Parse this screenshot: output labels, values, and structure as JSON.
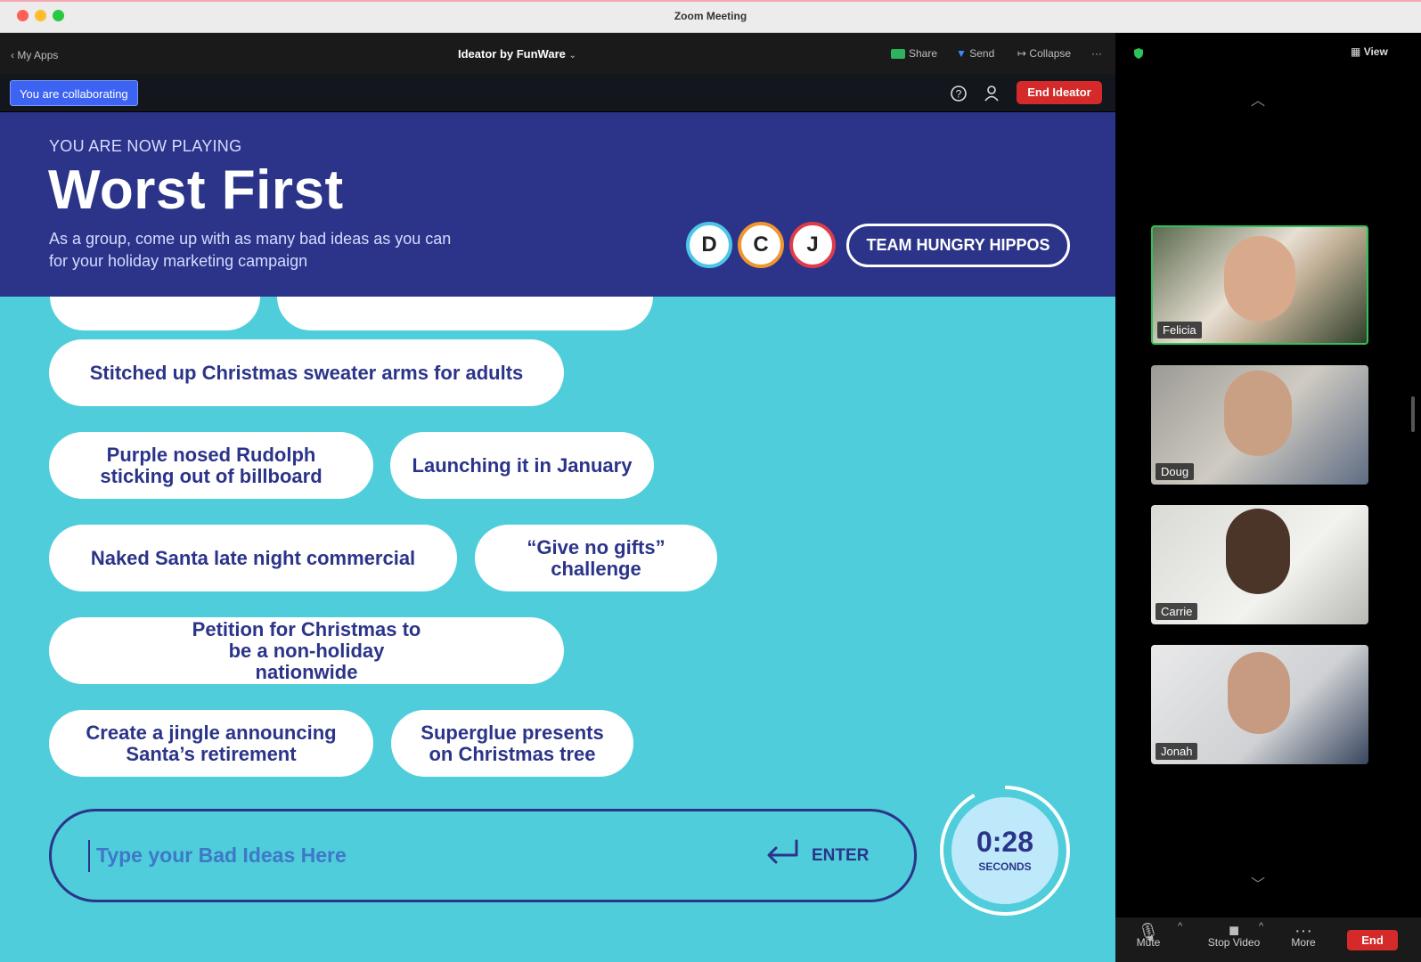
{
  "window": {
    "title": "Zoom Meeting"
  },
  "appbar": {
    "back_label": "My Apps",
    "app_title": "Ideator by FunWare",
    "share_label": "Share",
    "send_label": "Send",
    "collapse_label": "Collapse",
    "view_label": "View"
  },
  "toolbar": {
    "collab_badge": "You are collaborating",
    "end_label": "End Ideator"
  },
  "game": {
    "now_playing": "YOU ARE NOW PLAYING",
    "title": "Worst First",
    "description": "As a group, come up with as many bad ideas as you can for your holiday marketing campaign",
    "avatars": [
      "D",
      "C",
      "J"
    ],
    "team_name": "TEAM HUNGRY HIPPOS"
  },
  "ideas": [
    "Stitched up Christmas sweater arms for adults",
    "Purple nosed Rudolph sticking out of billboard",
    "Launching it in January",
    "Naked Santa late night commercial",
    "“Give no gifts” challenge",
    "Petition for Christmas to be a non-holiday nationwide",
    "Create a jingle announcing Santa’s retirement",
    "Superglue presents on Christmas tree"
  ],
  "input": {
    "placeholder": "Type your Bad Ideas Here",
    "enter_label": "ENTER"
  },
  "timer": {
    "value": "0:28",
    "unit": "SECONDS"
  },
  "participants": [
    "Felicia",
    "Doug",
    "Carrie",
    "Jonah"
  ],
  "controls": {
    "mute": "Mute",
    "stop_video": "Stop Video",
    "more": "More",
    "end": "End"
  },
  "colors": {
    "header_bg": "#2b3489",
    "board_bg": "#4fcddb",
    "accent_red": "#d42a2a",
    "collab_blue": "#3d63f2"
  }
}
